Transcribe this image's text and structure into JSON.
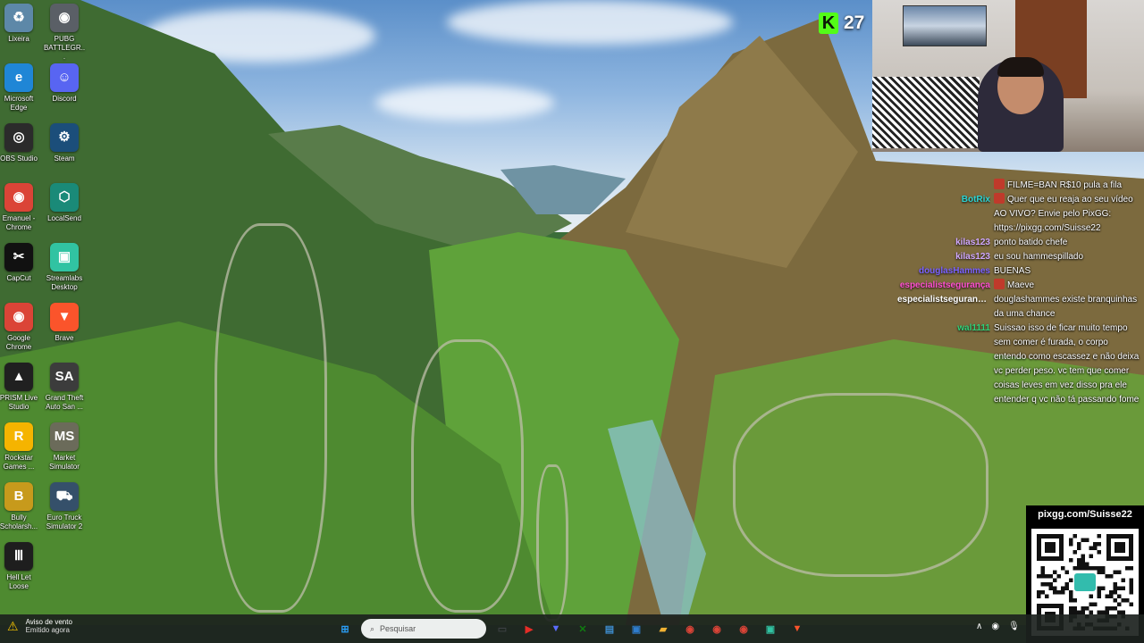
{
  "desktop": {
    "icons": [
      {
        "label": "Lixeira",
        "icon": "recycle-bin-icon",
        "color": "#5d88a8",
        "glyph": "♻"
      },
      {
        "label": "PUBG BATTLEGR...",
        "icon": "pubg-icon",
        "color": "#5a5f66",
        "glyph": "◉"
      },
      {
        "label": "Microsoft Edge",
        "icon": "edge-icon",
        "color": "#1f86d6",
        "glyph": "e"
      },
      {
        "label": "Discord",
        "icon": "discord-icon",
        "color": "#5865f2",
        "glyph": "☺"
      },
      {
        "label": "OBS Studio",
        "icon": "obs-icon",
        "color": "#2b2b2b",
        "glyph": "◎"
      },
      {
        "label": "Steam",
        "icon": "steam-icon",
        "color": "#1b4e7a",
        "glyph": "⚙"
      },
      {
        "label": "Emanuel - Chrome",
        "icon": "chrome-icon",
        "color": "#db4437",
        "glyph": "◉"
      },
      {
        "label": "LocalSend",
        "icon": "localsend-icon",
        "color": "#1a8a78",
        "glyph": "⬡"
      },
      {
        "label": "CapCut",
        "icon": "capcut-icon",
        "color": "#111111",
        "glyph": "✂"
      },
      {
        "label": "Streamlabs Desktop",
        "icon": "streamlabs-icon",
        "color": "#31c3a2",
        "glyph": "▣"
      },
      {
        "label": "Google Chrome",
        "icon": "chrome-icon",
        "color": "#db4437",
        "glyph": "◉"
      },
      {
        "label": "Brave",
        "icon": "brave-icon",
        "color": "#fb542b",
        "glyph": "▼"
      },
      {
        "label": "PRISM Live Studio",
        "icon": "prism-icon",
        "color": "#202020",
        "glyph": "▲"
      },
      {
        "label": "Grand Theft Auto San ...",
        "icon": "gta-sa-icon",
        "color": "#3c3c3c",
        "glyph": "SA"
      },
      {
        "label": "Rockstar Games ...",
        "icon": "rockstar-icon",
        "color": "#f5b400",
        "glyph": "R"
      },
      {
        "label": "Market Simulator",
        "icon": "market-simulator-icon",
        "color": "#6b6b5a",
        "glyph": "MS"
      },
      {
        "label": "Bully Scholarsh...",
        "icon": "bully-icon",
        "color": "#c79a1c",
        "glyph": "B"
      },
      {
        "label": "Euro Truck Simulator 2",
        "icon": "euro-truck-icon",
        "color": "#35506a",
        "glyph": "⛟"
      },
      {
        "label": "Hell Let Loose",
        "icon": "hell-let-loose-icon",
        "color": "#1e1e1e",
        "glyph": "Ⅲ"
      }
    ]
  },
  "stream": {
    "viewer_badge": "K",
    "viewer_count": "27",
    "kick_color": "#53fc18",
    "qr_url": "pixgg.com/Suisse22"
  },
  "chat": {
    "messages": [
      {
        "user": "",
        "user_color": "#ffffff",
        "text": "FILME=BAN  R$10 pula a fila",
        "emote": true
      },
      {
        "user": "BotRix",
        "user_color": "#2bd4d4",
        "text": "Quer que eu reaja ao seu vídeo AO VIVO? Envie pelo PixGG: https://pixgg.com/Suisse22",
        "emote": true
      },
      {
        "user": "kilas123",
        "user_color": "#d0a8ff",
        "text": "ponto batido chefe",
        "emote": false
      },
      {
        "user": "kilas123",
        "user_color": "#d0a8ff",
        "text": "eu sou hammespillado",
        "emote": false
      },
      {
        "user": "douglasHammes",
        "user_color": "#7a62ff",
        "text": "BUENAS",
        "emote": false
      },
      {
        "user": "especialistsegurança",
        "user_color": "#ff4fd2",
        "text": "Maeve",
        "emote": true
      },
      {
        "user": "especialistsegurançx...",
        "user_color": "#ffffff",
        "text": "douglashammes existe branquinhas da uma chance",
        "emote": false
      },
      {
        "user": "wal1111",
        "user_color": "#2fd27a",
        "text": "Suissao isso de ficar muito tempo sem comer é furada, o corpo entendo como escassez e não deixa vc perder peso. vc tem que comer coisas leves em vez disso pra ele entender q vc não tá passando fome",
        "emote": false
      }
    ]
  },
  "taskbar": {
    "notification_title": "Aviso de vento",
    "notification_subtitle": "Emitido agora",
    "search_placeholder": "Pesquisar",
    "pinned": [
      {
        "icon": "windows-start-icon",
        "color": "#2a9df4",
        "glyph": "⊞"
      },
      {
        "icon": "task-view-icon",
        "color": "#3b3f42",
        "glyph": "▭"
      },
      {
        "icon": "youtube-icon",
        "color": "#e52d27",
        "glyph": "▶"
      },
      {
        "icon": "vpn-icon",
        "color": "#5b6cff",
        "glyph": "▼"
      },
      {
        "icon": "xbox-icon",
        "color": "#107c10",
        "glyph": "✕"
      },
      {
        "icon": "notes-icon",
        "color": "#3e8ed0",
        "glyph": "▤"
      },
      {
        "icon": "monitor-icon",
        "color": "#2f7ccc",
        "glyph": "▣"
      },
      {
        "icon": "file-explorer-icon",
        "color": "#f2b233",
        "glyph": "▰"
      },
      {
        "icon": "chrome-icon",
        "color": "#db4437",
        "glyph": "◉"
      },
      {
        "icon": "chrome-icon",
        "color": "#db4437",
        "glyph": "◉"
      },
      {
        "icon": "chrome-icon",
        "color": "#db4437",
        "glyph": "◉"
      },
      {
        "icon": "streamlabs-icon",
        "color": "#31c3a2",
        "glyph": "▣"
      },
      {
        "icon": "brave-icon",
        "color": "#fb542b",
        "glyph": "▼"
      }
    ]
  }
}
